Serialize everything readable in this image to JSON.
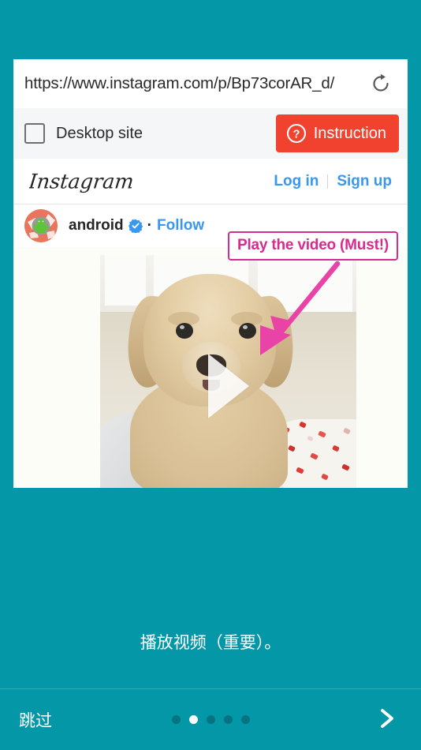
{
  "theme": {
    "background": "#0497a7",
    "accent_red": "#f1412f",
    "ig_blue": "#3897f0",
    "annotation_pink": "#d62b8f",
    "dot_inactive": "#057382",
    "dot_active": "#ffffff"
  },
  "browser": {
    "url": "https://www.instagram.com/p/Bp73corAR_d/",
    "reload_icon": "reload-icon",
    "desktop_site": {
      "label": "Desktop site",
      "checked": false
    },
    "instruction_button": {
      "label": "Instruction",
      "icon": "question-circle-icon"
    }
  },
  "instagram": {
    "logo_text": "Instagram",
    "login_label": "Log in",
    "signup_label": "Sign up",
    "separator": "|",
    "post": {
      "avatar_icon": "android-avatar-icon",
      "username": "android",
      "verified_icon": "verified-badge-icon",
      "bullet": "·",
      "follow_label": "Follow",
      "media_type": "video",
      "play_icon": "play-triangle-icon"
    }
  },
  "annotation": {
    "box_label": "Play the video (Must!)",
    "arrow_icon": "arrow-down-left-icon"
  },
  "tutorial": {
    "caption": "播放视频（重要）。",
    "skip_label": "跳过",
    "next_icon": "chevron-right-icon",
    "pagination": {
      "total": 5,
      "active_index": 1
    }
  }
}
